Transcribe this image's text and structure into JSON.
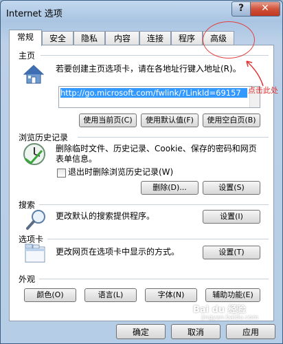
{
  "window": {
    "title": "Internet 选项",
    "help": "?",
    "close": "✕"
  },
  "tabs": [
    "常规",
    "安全",
    "隐私",
    "内容",
    "连接",
    "程序",
    "高级"
  ],
  "home": {
    "label": "主页",
    "desc": "若要创建主页选项卡，请在各地址行键入地址(R)。",
    "url": "http://go.microsoft.com/fwlink/?LinkId=69157",
    "btn_current": "使用当前页(C)",
    "btn_default": "使用默认值(F)",
    "btn_blank": "使用空白页(B)"
  },
  "history": {
    "label": "浏览历史记录",
    "desc_line1": "删除临时文件、历史记录、Cookie、保存的密码和网页",
    "desc_line2": "表单信息。",
    "checkbox_label": "退出时删除浏览历史记录(W)",
    "btn_delete": "删除(D)...",
    "btn_settings": "设置(S)"
  },
  "search": {
    "label": "搜索",
    "desc": "更改默认的搜索提供程序。",
    "btn_settings": "设置(I)"
  },
  "tabs_section": {
    "label": "选项卡",
    "desc": "更改网页在选项卡中显示的方式。",
    "btn_settings": "设置(T)"
  },
  "appearance": {
    "label": "外观",
    "btn_colors": "颜色(O)",
    "btn_languages": "语言(L)",
    "btn_fonts": "字体(N)",
    "btn_accessibility": "辅助功能(E)"
  },
  "footer": {
    "ok": "确定",
    "cancel": "取消",
    "apply": "应用"
  },
  "annotation": {
    "text": "点击此处",
    "color": "#e03030"
  },
  "watermark": {
    "brand": "Bai du 经验",
    "url": "jingyan.baidu.com"
  },
  "colors": {
    "selection": "#3399ff",
    "titlebar": "#a9c4e2",
    "close": "#c0381f"
  }
}
